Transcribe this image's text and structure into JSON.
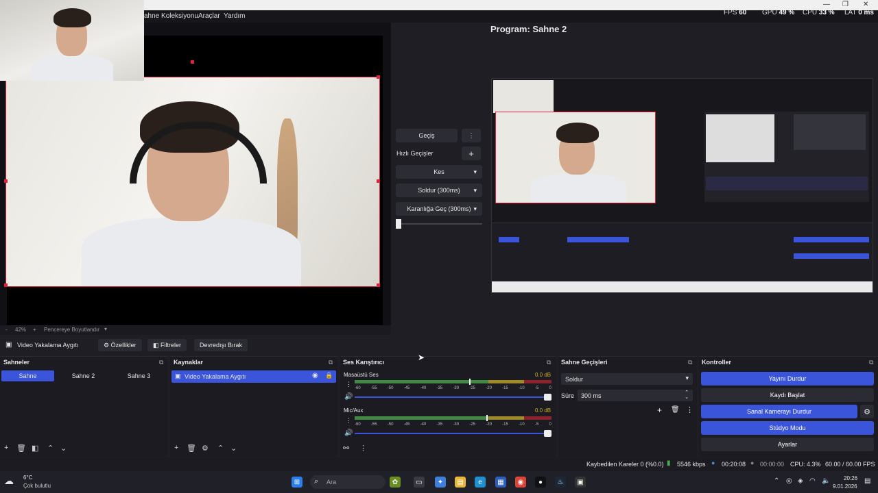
{
  "window": {
    "minimize": "—",
    "maximize": "❐",
    "close": "✕"
  },
  "menubar": {
    "items": [
      "ahne Koleksiyonu",
      "Araçlar",
      "Yardım"
    ]
  },
  "stats": {
    "fps_label": "FPS",
    "fps_value": "60",
    "gpu_label": "GPU",
    "gpu_value": "49 %",
    "cpu_label": "CPU",
    "cpu_value": "33 %",
    "lat_label": "LAT",
    "lat_value": "0 ms"
  },
  "preview": {
    "zoom": "42%",
    "zoom_plus": "+",
    "zoom_minus": "-",
    "fit_label": "Pencereye Boyutlandır"
  },
  "transitions": {
    "transition_button": "Geçiş",
    "quick_label": "Hızlı Geçişler",
    "items": [
      "Kes",
      "Soldur (300ms)",
      "Karanlığa Geç (300ms)"
    ]
  },
  "program": {
    "title": "Program: Sahne 2"
  },
  "source_toolbar": {
    "source_name": "Video Yakalama Aygıtı",
    "properties": "Özellikler",
    "filters": "Filtreler",
    "deactivate": "Devredışı Bırak"
  },
  "scenes": {
    "title": "Sahneler",
    "items": [
      "Sahne",
      "Sahne 2",
      "Sahne 3"
    ],
    "active_index": 0
  },
  "sources": {
    "title": "Kaynaklar",
    "items": [
      "Video Yakalama Aygıtı"
    ]
  },
  "mixer": {
    "title": "Ses Karıştırıcı",
    "channels": [
      {
        "name": "Masaüstü Ses",
        "db": "0.0 dB",
        "level": 0.62
      },
      {
        "name": "Mic/Aux",
        "db": "0.0 dB",
        "level": 0.14
      }
    ],
    "scale": [
      "-60",
      "-55",
      "-50",
      "-45",
      "-40",
      "-35",
      "-30",
      "-25",
      "-20",
      "-15",
      "-10",
      "-5",
      "0"
    ]
  },
  "scene_transitions": {
    "title": "Sahne Geçişleri",
    "selected": "Soldur",
    "duration_label": "Süre",
    "duration_value": "300 ms"
  },
  "controls": {
    "title": "Kontroller",
    "stop_stream": "Yayını Durdur",
    "start_record": "Kaydı Başlat",
    "stop_virtualcam": "Sanal Kamerayı Durdur",
    "studio_mode": "Stüdyo Modu",
    "settings": "Ayarlar"
  },
  "status": {
    "dropped_frames": "Kaybedilen Kareler 0 (%0.0)",
    "bitrate": "5546 kbps",
    "stream_time": "00:20:08",
    "record_time": "00:00:00",
    "cpu": "CPU: 4.3%",
    "fps": "60.00 / 60.00 FPS"
  },
  "taskbar": {
    "weather_temp": "6°C",
    "weather_desc": "Çok bulutlu",
    "search_placeholder": "Ara",
    "time": "20:26",
    "date": "9.01.2026"
  },
  "colors": {
    "accent": "#3a55d9",
    "record_red": "#e0233b",
    "panel_bg": "#1b1b21"
  }
}
